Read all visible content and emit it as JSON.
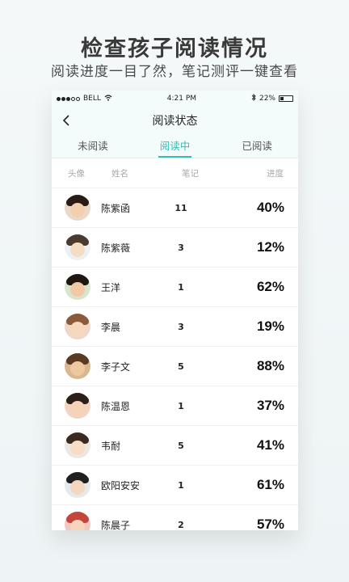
{
  "promo": {
    "headline": "检查孩子阅读情况",
    "subline": "阅读进度一目了然，笔记测评一键查看"
  },
  "statusbar": {
    "carrier": "BELL",
    "time": "4:21 PM",
    "battery": "22%"
  },
  "navbar": {
    "title": "阅读状态"
  },
  "tabs": [
    {
      "label": "未阅读",
      "active": false
    },
    {
      "label": "阅读中",
      "active": true
    },
    {
      "label": "已阅读",
      "active": false
    }
  ],
  "columns": {
    "avatar": "头像",
    "name": "姓名",
    "notes": "笔记",
    "progress": "进度"
  },
  "students": [
    {
      "name": "陈紫函",
      "notes": "11",
      "progress": "40%"
    },
    {
      "name": "陈紫薇",
      "notes": "3",
      "progress": "12%"
    },
    {
      "name": "王洋",
      "notes": "1",
      "progress": "62%"
    },
    {
      "name": "李晨",
      "notes": "3",
      "progress": "19%"
    },
    {
      "name": "李子文",
      "notes": "5",
      "progress": "88%"
    },
    {
      "name": "陈温恩",
      "notes": "1",
      "progress": "37%"
    },
    {
      "name": "韦耐",
      "notes": "5",
      "progress": "41%"
    },
    {
      "name": "欧阳安安",
      "notes": "1",
      "progress": "61%"
    },
    {
      "name": "陈晨子",
      "notes": "2",
      "progress": "57%"
    }
  ],
  "colors": {
    "accent": "#2dbfb6"
  }
}
